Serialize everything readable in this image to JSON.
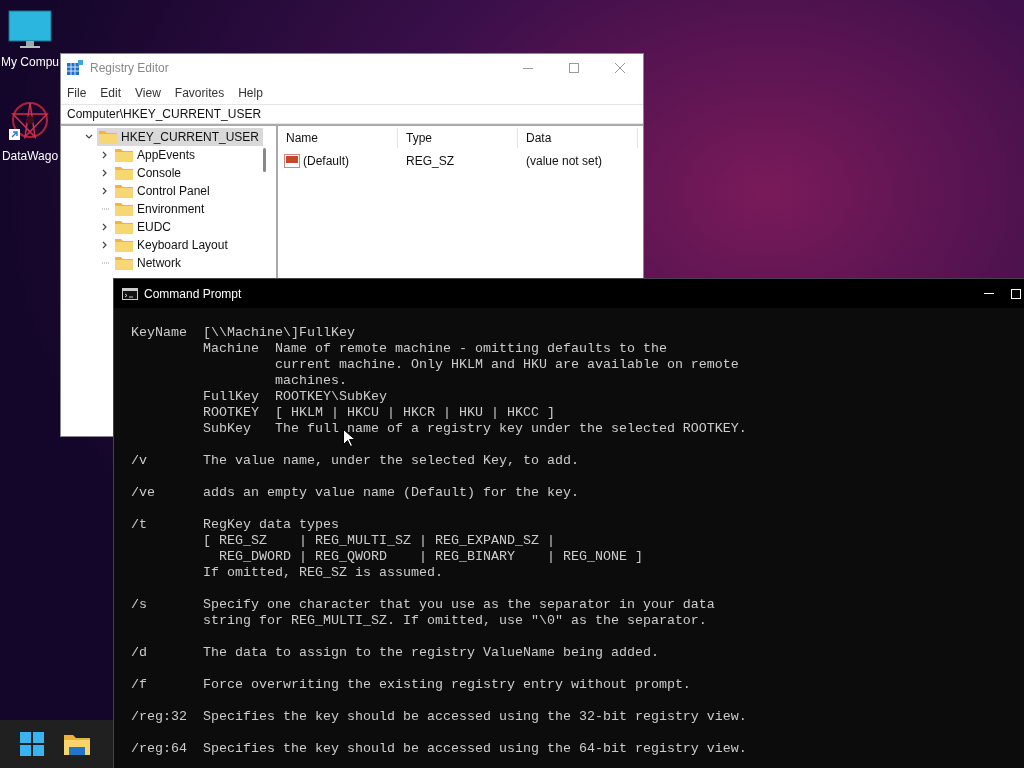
{
  "desktop_icons": [
    {
      "label": "My Compu",
      "kind": "monitor"
    },
    {
      "label": "DataWago",
      "kind": "app"
    }
  ],
  "registry_editor": {
    "title": "Registry Editor",
    "menu": [
      "File",
      "Edit",
      "View",
      "Favorites",
      "Help"
    ],
    "address": "Computer\\HKEY_CURRENT_USER",
    "tree": {
      "label": "HKEY_CURRENT_USER",
      "expanded": true,
      "selected": true,
      "children": [
        {
          "label": "AppEvents",
          "expandable": true,
          "selected": false
        },
        {
          "label": "Console",
          "expandable": true,
          "selected": false
        },
        {
          "label": "Control Panel",
          "expandable": true,
          "selected": false
        },
        {
          "label": "Environment",
          "expandable": false,
          "selected": false
        },
        {
          "label": "EUDC",
          "expandable": true,
          "selected": false
        },
        {
          "label": "Keyboard Layout",
          "expandable": true,
          "selected": false
        },
        {
          "label": "Network",
          "expandable": false,
          "selected": false
        }
      ]
    },
    "columns": [
      "Name",
      "Type",
      "Data"
    ],
    "rows": [
      {
        "name": "(Default)",
        "type": "REG_SZ",
        "data": "(value not set)"
      }
    ]
  },
  "command_prompt": {
    "title": "Command Prompt",
    "blocks": [
      [
        "KeyName  [\\\\Machine\\]FullKey",
        "         Machine  Name of remote machine - omitting defaults to the",
        "                  current machine. Only HKLM and HKU are available on remote",
        "                  machines.",
        "         FullKey  ROOTKEY\\SubKey",
        "         ROOTKEY  [ HKLM | HKCU | HKCR | HKU | HKCC ]",
        "         SubKey   The full name of a registry key under the selected ROOTKEY."
      ],
      [
        "/v       The value name, under the selected Key, to add."
      ],
      [
        "/ve      adds an empty value name (Default) for the key."
      ],
      [
        "/t       RegKey data types",
        "         [ REG_SZ    | REG_MULTI_SZ | REG_EXPAND_SZ |",
        "           REG_DWORD | REG_QWORD    | REG_BINARY    | REG_NONE ]",
        "         If omitted, REG_SZ is assumed."
      ],
      [
        "/s       Specify one character that you use as the separator in your data",
        "         string for REG_MULTI_SZ. If omitted, use \"\\0\" as the separator."
      ],
      [
        "/d       The data to assign to the registry ValueName being added."
      ],
      [
        "/f       Force overwriting the existing registry entry without prompt."
      ],
      [
        "/reg:32  Specifies the key should be accessed using the 32-bit registry view."
      ],
      [
        "/reg:64  Specifies the key should be accessed using the 64-bit registry view."
      ]
    ]
  }
}
